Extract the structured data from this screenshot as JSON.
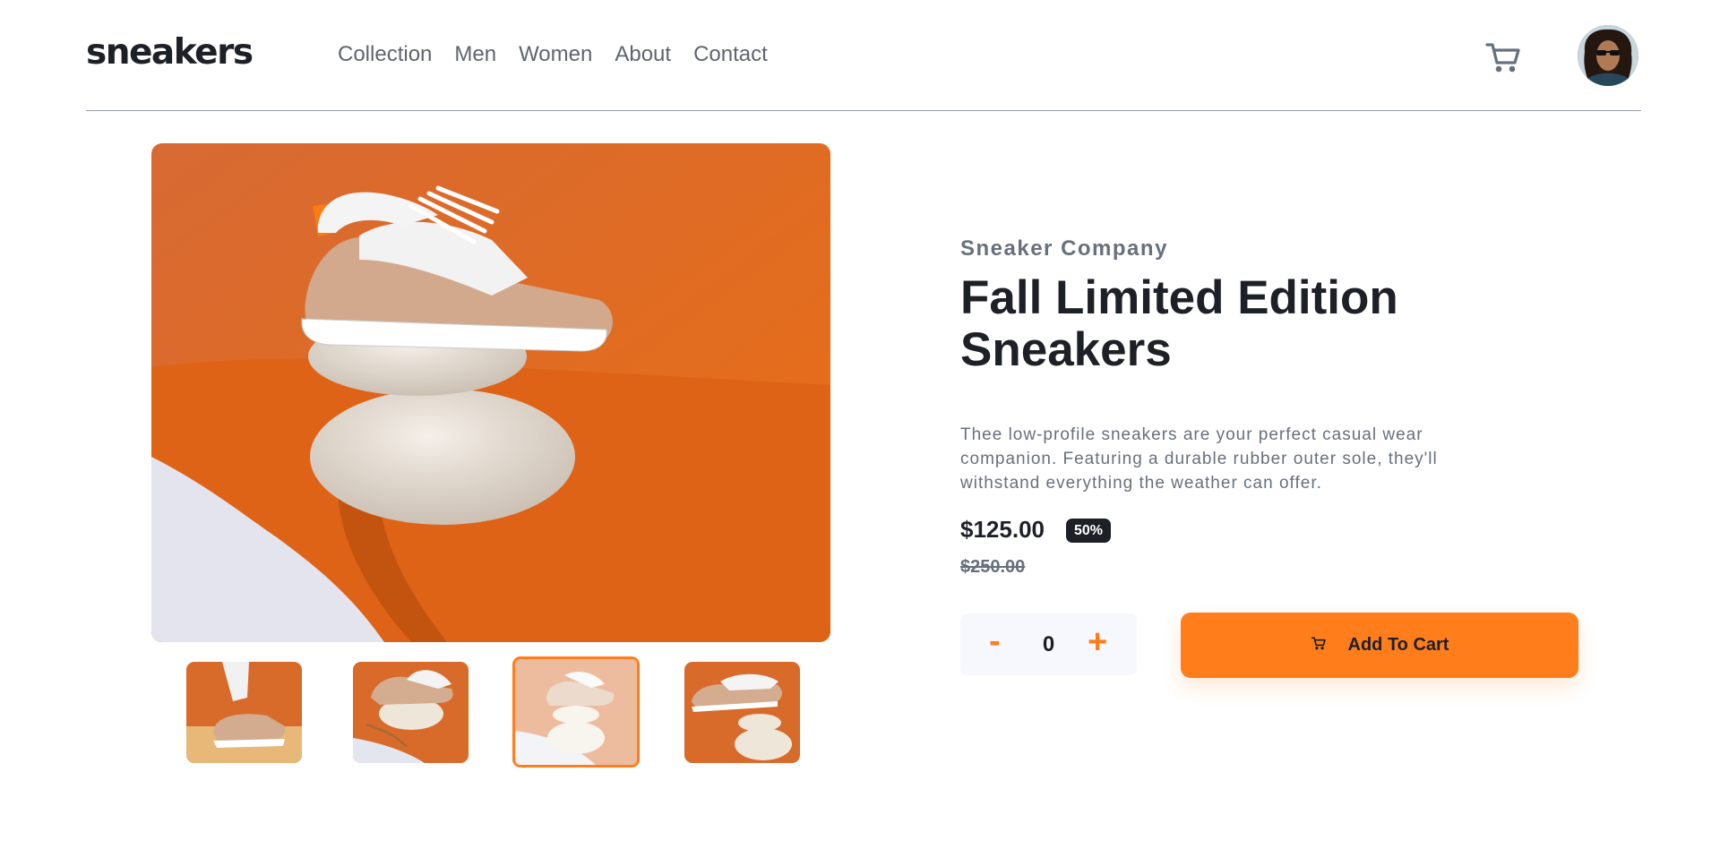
{
  "header": {
    "logo": "sneakers",
    "nav": [
      "Collection",
      "Men",
      "Women",
      "About",
      "Contact"
    ],
    "cart_icon": "cart-icon",
    "avatar": "user-avatar"
  },
  "gallery": {
    "main_image": "product-image-sneaker-on-stones",
    "thumbnails": [
      "thumbnail-1",
      "thumbnail-2",
      "thumbnail-3",
      "thumbnail-4"
    ],
    "active_thumbnail": 3
  },
  "product": {
    "company": "Sneaker Company",
    "title_line1": "Fall Limited Edition",
    "title_line2": "Sneakers",
    "description": "Thee low-profile sneakers are your perfect casual wear companion. Featuring a durable rubber outer sole, they'll withstand everything the weather can offer.",
    "price": "$125.00",
    "discount": "50%",
    "original_price": "$250.00"
  },
  "cart_controls": {
    "minus_label": "-",
    "quantity": "0",
    "plus_label": "+",
    "add_to_cart_label": "Add To Cart"
  },
  "colors": {
    "accent": "#ff7e1b",
    "dark": "#1d2026",
    "text_muted": "#68707d",
    "light_bg": "#f6f8fd"
  }
}
